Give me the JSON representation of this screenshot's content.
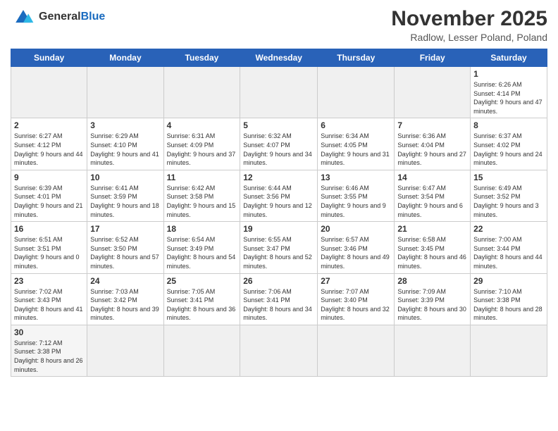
{
  "header": {
    "logo_general": "General",
    "logo_blue": "Blue",
    "month_title": "November 2025",
    "subtitle": "Radlow, Lesser Poland, Poland"
  },
  "weekdays": [
    "Sunday",
    "Monday",
    "Tuesday",
    "Wednesday",
    "Thursday",
    "Friday",
    "Saturday"
  ],
  "weeks": [
    [
      {
        "day": "",
        "info": ""
      },
      {
        "day": "",
        "info": ""
      },
      {
        "day": "",
        "info": ""
      },
      {
        "day": "",
        "info": ""
      },
      {
        "day": "",
        "info": ""
      },
      {
        "day": "",
        "info": ""
      },
      {
        "day": "1",
        "info": "Sunrise: 6:26 AM\nSunset: 4:14 PM\nDaylight: 9 hours\nand 47 minutes."
      }
    ],
    [
      {
        "day": "2",
        "info": "Sunrise: 6:27 AM\nSunset: 4:12 PM\nDaylight: 9 hours\nand 44 minutes."
      },
      {
        "day": "3",
        "info": "Sunrise: 6:29 AM\nSunset: 4:10 PM\nDaylight: 9 hours\nand 41 minutes."
      },
      {
        "day": "4",
        "info": "Sunrise: 6:31 AM\nSunset: 4:09 PM\nDaylight: 9 hours\nand 37 minutes."
      },
      {
        "day": "5",
        "info": "Sunrise: 6:32 AM\nSunset: 4:07 PM\nDaylight: 9 hours\nand 34 minutes."
      },
      {
        "day": "6",
        "info": "Sunrise: 6:34 AM\nSunset: 4:05 PM\nDaylight: 9 hours\nand 31 minutes."
      },
      {
        "day": "7",
        "info": "Sunrise: 6:36 AM\nSunset: 4:04 PM\nDaylight: 9 hours\nand 27 minutes."
      },
      {
        "day": "8",
        "info": "Sunrise: 6:37 AM\nSunset: 4:02 PM\nDaylight: 9 hours\nand 24 minutes."
      }
    ],
    [
      {
        "day": "9",
        "info": "Sunrise: 6:39 AM\nSunset: 4:01 PM\nDaylight: 9 hours\nand 21 minutes."
      },
      {
        "day": "10",
        "info": "Sunrise: 6:41 AM\nSunset: 3:59 PM\nDaylight: 9 hours\nand 18 minutes."
      },
      {
        "day": "11",
        "info": "Sunrise: 6:42 AM\nSunset: 3:58 PM\nDaylight: 9 hours\nand 15 minutes."
      },
      {
        "day": "12",
        "info": "Sunrise: 6:44 AM\nSunset: 3:56 PM\nDaylight: 9 hours\nand 12 minutes."
      },
      {
        "day": "13",
        "info": "Sunrise: 6:46 AM\nSunset: 3:55 PM\nDaylight: 9 hours\nand 9 minutes."
      },
      {
        "day": "14",
        "info": "Sunrise: 6:47 AM\nSunset: 3:54 PM\nDaylight: 9 hours\nand 6 minutes."
      },
      {
        "day": "15",
        "info": "Sunrise: 6:49 AM\nSunset: 3:52 PM\nDaylight: 9 hours\nand 3 minutes."
      }
    ],
    [
      {
        "day": "16",
        "info": "Sunrise: 6:51 AM\nSunset: 3:51 PM\nDaylight: 9 hours\nand 0 minutes."
      },
      {
        "day": "17",
        "info": "Sunrise: 6:52 AM\nSunset: 3:50 PM\nDaylight: 8 hours\nand 57 minutes."
      },
      {
        "day": "18",
        "info": "Sunrise: 6:54 AM\nSunset: 3:49 PM\nDaylight: 8 hours\nand 54 minutes."
      },
      {
        "day": "19",
        "info": "Sunrise: 6:55 AM\nSunset: 3:47 PM\nDaylight: 8 hours\nand 52 minutes."
      },
      {
        "day": "20",
        "info": "Sunrise: 6:57 AM\nSunset: 3:46 PM\nDaylight: 8 hours\nand 49 minutes."
      },
      {
        "day": "21",
        "info": "Sunrise: 6:58 AM\nSunset: 3:45 PM\nDaylight: 8 hours\nand 46 minutes."
      },
      {
        "day": "22",
        "info": "Sunrise: 7:00 AM\nSunset: 3:44 PM\nDaylight: 8 hours\nand 44 minutes."
      }
    ],
    [
      {
        "day": "23",
        "info": "Sunrise: 7:02 AM\nSunset: 3:43 PM\nDaylight: 8 hours\nand 41 minutes."
      },
      {
        "day": "24",
        "info": "Sunrise: 7:03 AM\nSunset: 3:42 PM\nDaylight: 8 hours\nand 39 minutes."
      },
      {
        "day": "25",
        "info": "Sunrise: 7:05 AM\nSunset: 3:41 PM\nDaylight: 8 hours\nand 36 minutes."
      },
      {
        "day": "26",
        "info": "Sunrise: 7:06 AM\nSunset: 3:41 PM\nDaylight: 8 hours\nand 34 minutes."
      },
      {
        "day": "27",
        "info": "Sunrise: 7:07 AM\nSunset: 3:40 PM\nDaylight: 8 hours\nand 32 minutes."
      },
      {
        "day": "28",
        "info": "Sunrise: 7:09 AM\nSunset: 3:39 PM\nDaylight: 8 hours\nand 30 minutes."
      },
      {
        "day": "29",
        "info": "Sunrise: 7:10 AM\nSunset: 3:38 PM\nDaylight: 8 hours\nand 28 minutes."
      }
    ],
    [
      {
        "day": "30",
        "info": "Sunrise: 7:12 AM\nSunset: 3:38 PM\nDaylight: 8 hours\nand 26 minutes."
      },
      {
        "day": "",
        "info": ""
      },
      {
        "day": "",
        "info": ""
      },
      {
        "day": "",
        "info": ""
      },
      {
        "day": "",
        "info": ""
      },
      {
        "day": "",
        "info": ""
      },
      {
        "day": "",
        "info": ""
      }
    ]
  ]
}
